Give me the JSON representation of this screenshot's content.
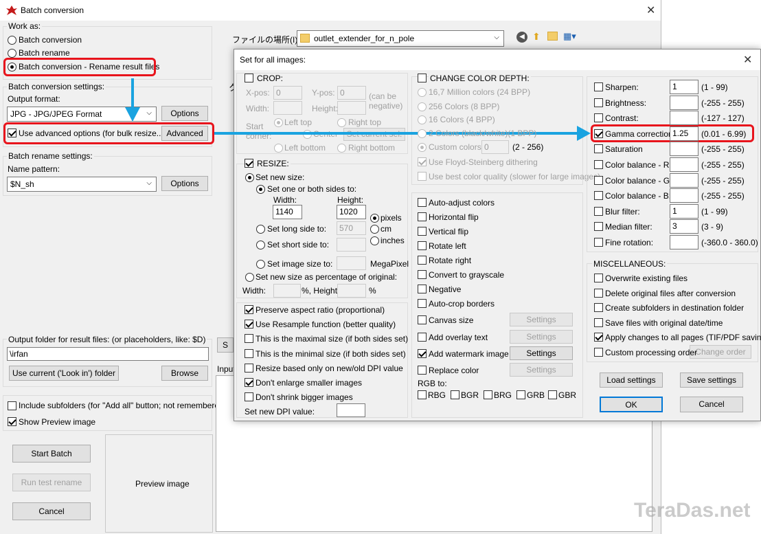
{
  "main": {
    "title": "Batch conversion",
    "work_as": {
      "label": "Work as:",
      "options": [
        "Batch conversion",
        "Batch rename",
        "Batch conversion - Rename result files"
      ]
    },
    "conv_settings": {
      "label": "Batch conversion settings:",
      "output_format_label": "Output format:",
      "output_format_value": "JPG - JPG/JPEG Format",
      "options_btn": "Options",
      "advanced_chk": "Use advanced options (for bulk resize...)",
      "advanced_btn": "Advanced"
    },
    "rename_settings": {
      "label": "Batch rename settings:",
      "name_pattern_label": "Name pattern:",
      "name_pattern_value": "$N_sh",
      "options_btn": "Options"
    },
    "output_folder": {
      "label": "Output folder for result files: (or placeholders, like: $D)",
      "value": "\\irfan",
      "use_current_btn": "Use current ('Look in') folder",
      "browse_btn": "Browse"
    },
    "include_subfolders": "Include subfolders (for \"Add all\" button; not remembered)",
    "show_preview": "Show Preview image",
    "start_btn": "Start Batch",
    "run_test_btn": "Run test rename",
    "cancel_btn": "Cancel",
    "preview_label": "Preview image",
    "look_in_label": "ファイルの場所(I):",
    "look_in_value": "outlet_extender_for_n_pole",
    "partial": {
      "ku": "ク",
      "s": "S",
      "input": "Input"
    }
  },
  "dialog": {
    "title": "Set for all images:",
    "crop": {
      "label": "CROP:",
      "xpos": "X-pos:",
      "xpos_val": "0",
      "ypos": "Y-pos:",
      "ypos_val": "0",
      "can_be_neg": "(can be negative)",
      "width": "Width:",
      "height": "Height:",
      "start_corner": "Start corner:",
      "left_top": "Left top",
      "right_top": "Right top",
      "center": "Center",
      "set_current": "Set current sel.",
      "left_bottom": "Left bottom",
      "right_bottom": "Right bottom"
    },
    "resize": {
      "label": "RESIZE:",
      "set_new_size": "Set new size:",
      "set_one_or_both": "Set one or both sides to:",
      "width_label": "Width:",
      "height_label": "Height:",
      "width_val": "1140",
      "height_val": "1020",
      "pixels": "pixels",
      "cm": "cm",
      "inches": "inches",
      "long_side": "Set long side to:",
      "long_side_val": "570",
      "short_side": "Set short side to:",
      "image_size": "Set image size to:",
      "megapixel": "MegaPixel",
      "percentage": "Set new size as percentage of original:",
      "pct_width": "Width:",
      "pct_height": "%, Height:",
      "pct": "%"
    },
    "resize_opts": [
      {
        "label": "Preserve aspect ratio (proportional)",
        "checked": true
      },
      {
        "label": "Use Resample function (better quality)",
        "checked": true
      },
      {
        "label": "This is the maximal size (if both sides set)",
        "checked": false
      },
      {
        "label": "This is the minimal size (if both sides set)",
        "checked": false
      },
      {
        "label": "Resize based only on new/old DPI value",
        "checked": false
      },
      {
        "label": "Don't enlarge smaller images",
        "checked": true
      },
      {
        "label": "Don't shrink bigger images",
        "checked": false
      }
    ],
    "dpi_label": "Set new DPI value:",
    "color_depth": {
      "label": "CHANGE COLOR DEPTH:",
      "options": [
        "16,7 Million colors (24 BPP)",
        "256 Colors (8 BPP)",
        "16 Colors (4 BPP)",
        "2 Colors (black/white)(1 BPP)"
      ],
      "custom": "Custom colors:",
      "custom_val": "0",
      "custom_range": "(2 - 256)",
      "floyd": "Use Floyd-Steinberg dithering",
      "best_quality": "Use best color quality (slower for large images)"
    },
    "ops": [
      {
        "label": "Auto-adjust colors",
        "checked": false
      },
      {
        "label": "Horizontal flip",
        "checked": false
      },
      {
        "label": "Vertical flip",
        "checked": false
      },
      {
        "label": "Rotate left",
        "checked": false
      },
      {
        "label": "Rotate right",
        "checked": false
      },
      {
        "label": "Convert to grayscale",
        "checked": false
      },
      {
        "label": "Negative",
        "checked": false
      },
      {
        "label": "Auto-crop borders",
        "checked": false
      },
      {
        "label": "Canvas size",
        "checked": false,
        "btn": "Settings",
        "btn_enabled": false
      },
      {
        "label": "Add overlay text",
        "checked": false,
        "btn": "Settings",
        "btn_enabled": false
      },
      {
        "label": "Add watermark image",
        "checked": true,
        "btn": "Settings",
        "btn_enabled": true
      },
      {
        "label": "Replace color",
        "checked": false,
        "btn": "Settings",
        "btn_enabled": false
      }
    ],
    "rgb_to": {
      "label": "RGB to:",
      "options": [
        "RBG",
        "BGR",
        "BRG",
        "GRB",
        "GBR"
      ]
    },
    "adjust": [
      {
        "label": "Sharpen:",
        "value": "1",
        "range": "(1  -  99)",
        "checked": false
      },
      {
        "label": "Brightness:",
        "value": "",
        "range": "(-255  -  255)",
        "checked": false
      },
      {
        "label": "Contrast:",
        "value": "",
        "range": "(-127  -  127)",
        "checked": false
      },
      {
        "label": "Gamma correction:",
        "value": "1.25",
        "range": "(0.01  -  6.99)",
        "checked": true
      },
      {
        "label": "Saturation",
        "value": "",
        "range": "(-255  -  255)",
        "checked": false
      },
      {
        "label": "Color balance - R:",
        "value": "",
        "range": "(-255  -  255)",
        "checked": false
      },
      {
        "label": "Color balance - G:",
        "value": "",
        "range": "(-255  -  255)",
        "checked": false
      },
      {
        "label": "Color balance - B:",
        "value": "",
        "range": "(-255  -  255)",
        "checked": false
      },
      {
        "label": "Blur filter:",
        "value": "1",
        "range": "(1  -  99)",
        "checked": false
      },
      {
        "label": "Median filter:",
        "value": "3",
        "range": "(3  -  9)",
        "checked": false
      },
      {
        "label": "Fine rotation:",
        "value": "",
        "range": "(-360.0  -  360.0)",
        "checked": false
      }
    ],
    "misc": {
      "label": "MISCELLANEOUS:",
      "items": [
        {
          "label": "Overwrite existing files",
          "checked": false
        },
        {
          "label": "Delete original files after conversion",
          "checked": false
        },
        {
          "label": "Create subfolders in destination folder",
          "checked": false
        },
        {
          "label": "Save files with original date/time",
          "checked": false
        },
        {
          "label": "Apply changes to all pages (TIF/PDF saving)",
          "checked": true
        },
        {
          "label": "Custom processing order",
          "checked": false
        }
      ],
      "change_order": "Change order"
    },
    "load_btn": "Load settings",
    "save_btn": "Save settings",
    "ok_btn": "OK",
    "cancel_btn": "Cancel"
  },
  "watermark": "TeraDas.net",
  "colors": {
    "highlight_red": "#e8141c",
    "arrow_blue": "#1aa3e0",
    "dialog_bg": "#f0f0f0",
    "ok_border": "#0078d7"
  }
}
